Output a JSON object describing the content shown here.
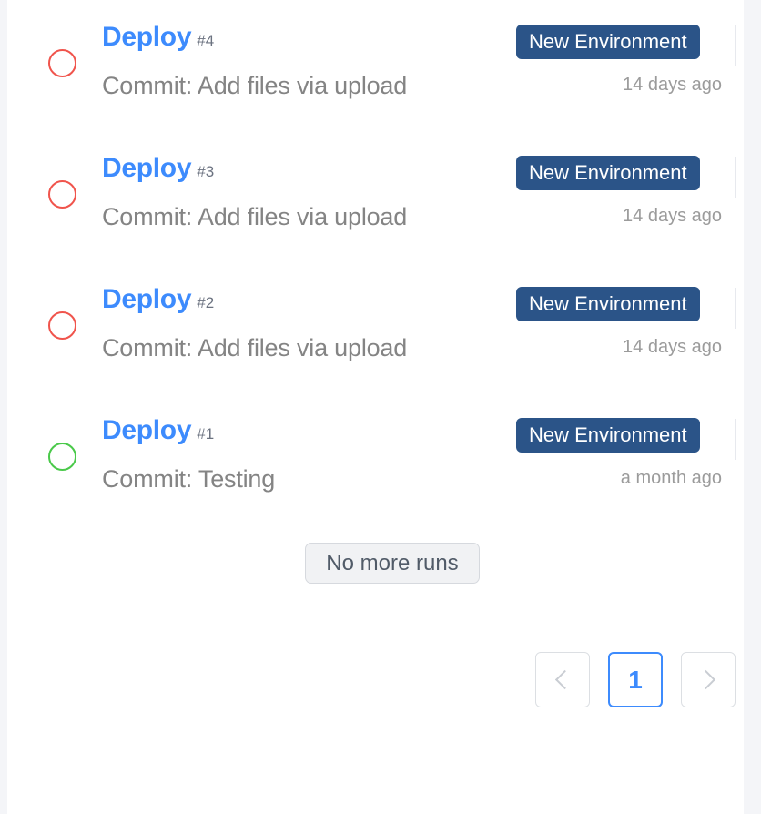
{
  "colors": {
    "page_background": "#f4f5f8",
    "card_background": "#ffffff",
    "link_blue": "#3d8bfd",
    "badge_blue": "#2b5488",
    "status_failed": "#f0544c",
    "status_success": "#4ac94a",
    "text_muted": "#9b9b9b",
    "commit_text": "#848484"
  },
  "runs": [
    {
      "status_icon": "circle-outline-failed-icon",
      "status_color": "red",
      "name": "Deploy",
      "number": "#4",
      "commit": "Commit: Add files via upload",
      "environment_badge": "New Environment",
      "time": "14 days ago"
    },
    {
      "status_icon": "circle-outline-failed-icon",
      "status_color": "red",
      "name": "Deploy",
      "number": "#3",
      "commit": "Commit: Add files via upload",
      "environment_badge": "New Environment",
      "time": "14 days ago"
    },
    {
      "status_icon": "circle-outline-failed-icon",
      "status_color": "red",
      "name": "Deploy",
      "number": "#2",
      "commit": "Commit: Add files via upload",
      "environment_badge": "New Environment",
      "time": "14 days ago"
    },
    {
      "status_icon": "circle-outline-success-icon",
      "status_color": "green",
      "name": "Deploy",
      "number": "#1",
      "commit": "Commit: Testing",
      "environment_badge": "New Environment",
      "time": "a month ago"
    }
  ],
  "no_more_runs": {
    "label": "No more runs"
  },
  "pagination": {
    "prev_label": "",
    "prev_icon": "chevron-left-icon",
    "pages": [
      {
        "label": "1",
        "active": true
      }
    ],
    "next_label": "",
    "next_icon": "chevron-right-icon",
    "current_page": "1"
  }
}
